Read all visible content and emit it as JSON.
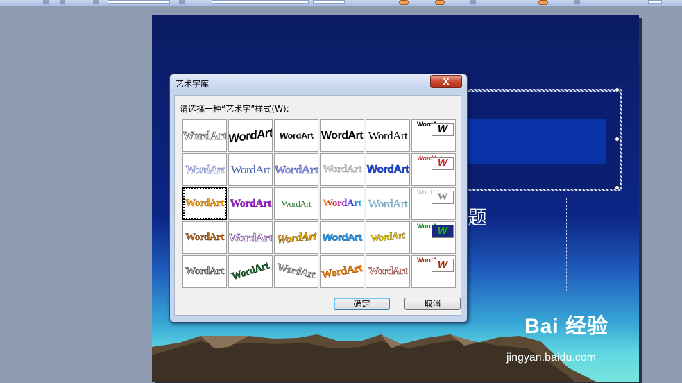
{
  "slide": {
    "subtitle_fragment": "题"
  },
  "dialog": {
    "title": "艺术字库",
    "close_glyph": "X",
    "prompt": "请选择一种“艺术字”样式(W):",
    "ok_label": "确定",
    "cancel_label": "取消",
    "gallery": [
      [
        "WordArt",
        "WordArt",
        "WordArt",
        "WordArt",
        "WordArt",
        "WordArt"
      ],
      [
        "WordArt",
        "WordArt",
        "WordArt",
        "WordArt",
        "WordArt",
        "WordArt"
      ],
      [
        "WordArt",
        "WordArt",
        "WordArt",
        "WordArt",
        "WordArt",
        "WordArt"
      ],
      [
        "WordArt",
        "WordArt",
        "WordArt",
        "WordArt",
        "WordArt",
        "WordArt"
      ],
      [
        "WordArt",
        "WordArt",
        "WordArt",
        "WordArt",
        "WordArt",
        "WordArt"
      ]
    ],
    "vertical_sample": "WordArt",
    "vertical_badge": "W",
    "selected_cell": [
      3,
      1
    ]
  },
  "watermark": {
    "brand": "Bai 经验",
    "url": "jingyan.baidu.com"
  }
}
